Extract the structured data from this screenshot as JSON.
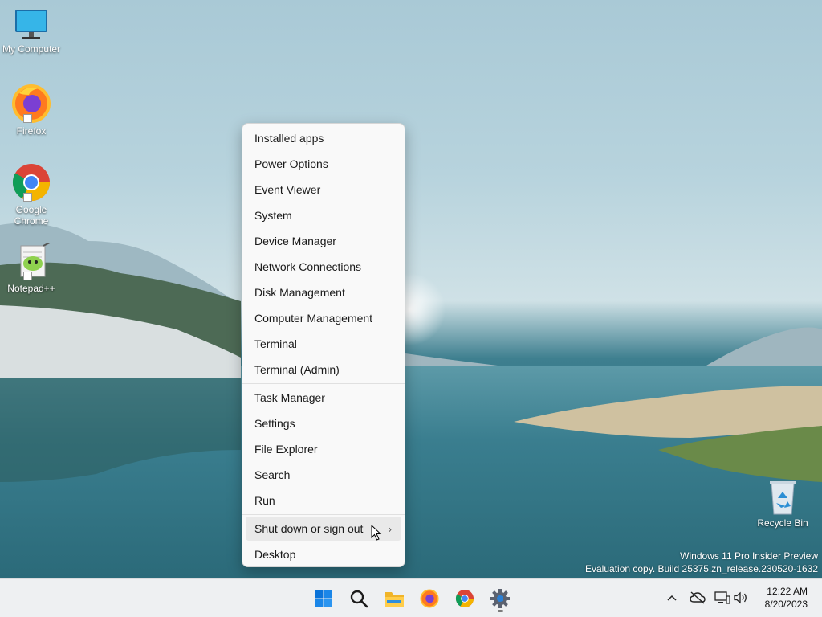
{
  "desktop": {
    "icons": [
      {
        "label": "My Computer"
      },
      {
        "label": "Firefox"
      },
      {
        "label": "Google Chrome"
      },
      {
        "label": "Notepad++"
      },
      {
        "label": "Recycle Bin"
      }
    ],
    "watermark": {
      "line1": "Windows 11 Pro Insider Preview",
      "line2": "Evaluation copy. Build 25375.zn_release.230520-1632"
    }
  },
  "context_menu": {
    "items": [
      {
        "label": "Installed apps"
      },
      {
        "label": "Power Options"
      },
      {
        "label": "Event Viewer"
      },
      {
        "label": "System"
      },
      {
        "label": "Device Manager"
      },
      {
        "label": "Network Connections"
      },
      {
        "label": "Disk Management"
      },
      {
        "label": "Computer Management"
      },
      {
        "label": "Terminal"
      },
      {
        "label": "Terminal (Admin)"
      },
      {
        "label": "Task Manager"
      },
      {
        "label": "Settings"
      },
      {
        "label": "File Explorer"
      },
      {
        "label": "Search"
      },
      {
        "label": "Run"
      },
      {
        "label": "Shut down or sign out",
        "submenu": true,
        "hovered": true
      },
      {
        "label": "Desktop"
      }
    ],
    "submenu_glyph": "›"
  },
  "taskbar": {
    "pinned": [
      {
        "icon": "windows-start-icon"
      },
      {
        "icon": "search-icon"
      },
      {
        "icon": "file-explorer-icon"
      },
      {
        "icon": "firefox-icon"
      },
      {
        "icon": "chrome-icon"
      },
      {
        "icon": "settings-icon",
        "active": true
      }
    ],
    "tray": {
      "icons": [
        "chevron-up-icon",
        "onedrive-offline-icon",
        "network-icon",
        "volume-icon"
      ],
      "time": "12:22 AM",
      "date": "8/20/2023"
    }
  },
  "colors": {
    "accent": "#0067c0",
    "menu_bg": "#f9f9f9",
    "taskbar_bg": "#eef0f2"
  }
}
